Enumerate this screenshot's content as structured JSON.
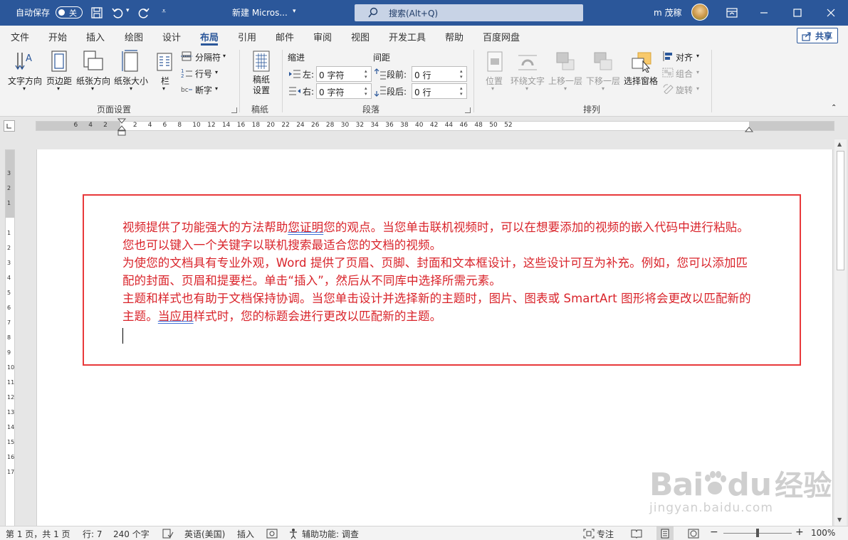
{
  "titlebar": {
    "autosave_label": "自动保存",
    "autosave_state": "关",
    "doc_title": "新建 Micros...",
    "search_placeholder": "搜索(Alt+Q)",
    "user_name": "m 茂稼"
  },
  "tabs": [
    "文件",
    "开始",
    "插入",
    "绘图",
    "设计",
    "布局",
    "引用",
    "邮件",
    "审阅",
    "视图",
    "开发工具",
    "帮助",
    "百度网盘"
  ],
  "active_tab": "布局",
  "share_label": "共享",
  "ribbon": {
    "page_setup": {
      "label": "页面设置",
      "text_direction": "文字方向",
      "margins": "页边距",
      "orientation": "纸张方向",
      "size": "纸张大小",
      "columns": "栏",
      "breaks": "分隔符",
      "line_numbers": "行号",
      "hyphenation": "断字"
    },
    "draft": {
      "label": "稿纸",
      "button": "稿纸设置"
    },
    "paragraph": {
      "label": "段落",
      "indent_header": "缩进",
      "spacing_header": "间距",
      "left_label": "左:",
      "right_label": "右:",
      "left_value": "0 字符",
      "right_value": "0 字符",
      "before_label": "段前:",
      "after_label": "段后:",
      "before_value": "0 行",
      "after_value": "0 行"
    },
    "arrange": {
      "label": "排列",
      "position": "位置",
      "wrap_text": "环绕文字",
      "bring_forward": "上移一层",
      "send_backward": "下移一层",
      "selection_pane": "选择窗格",
      "align": "对齐",
      "group": "组合",
      "rotate": "旋转"
    }
  },
  "ruler": {
    "numbers": [
      "6",
      "4",
      "2",
      "2",
      "4",
      "6",
      "8",
      "10",
      "12",
      "14",
      "16",
      "18",
      "20",
      "22",
      "24",
      "26",
      "28",
      "30",
      "32",
      "34",
      "36",
      "38",
      "40",
      "42",
      "44",
      "46",
      "48",
      "50",
      "52"
    ]
  },
  "vruler": {
    "numbers": [
      "3",
      "2",
      "1",
      "1",
      "2",
      "3",
      "4",
      "5",
      "6",
      "7",
      "8",
      "9",
      "10",
      "11",
      "12",
      "13",
      "14",
      "15",
      "16",
      "17"
    ]
  },
  "document": {
    "paragraphs": [
      {
        "pre": "视频提供了功能强大的方法帮助",
        "ul": "您证明",
        "post": "您的观点。当您单击联机视频时，可以在想要添加的视频的嵌入代码中进行粘贴。您也可以键入一个关键字以联机搜索最适合您的文档的视频。"
      },
      {
        "pre": "为使您的文档具有专业外观，Word 提供了页眉、页脚、封面和文本框设计，这些设计可互为补充。例如，您可以添加匹配的封面、页眉和提要栏。单击“插入”，然后从不同库中选择所需元素。",
        "ul": "",
        "post": ""
      },
      {
        "pre": "主题和样式也有助于文档保持协调。当您单击设计并选择新的主题时，图片、图表或 SmartArt 图形将会更改以匹配新的主题。",
        "ul": "当应用",
        "post": "样式时，您的标题会进行更改以匹配新的主题。"
      }
    ]
  },
  "status": {
    "page": "第 1 页，共 1 页",
    "line": "行: 7",
    "words": "240 个字",
    "language": "英语(美国)",
    "insert_mode": "插入",
    "accessibility": "辅助功能: 调查",
    "focus": "专注",
    "zoom": "100%"
  },
  "watermark": {
    "brand": "Bai",
    "brand2": "du",
    "cn": "经验",
    "url": "jingyan.baidu.com"
  },
  "colors": {
    "title_bg": "#2b579a",
    "doc_text": "#d9232a",
    "box_border": "#e8393b"
  }
}
